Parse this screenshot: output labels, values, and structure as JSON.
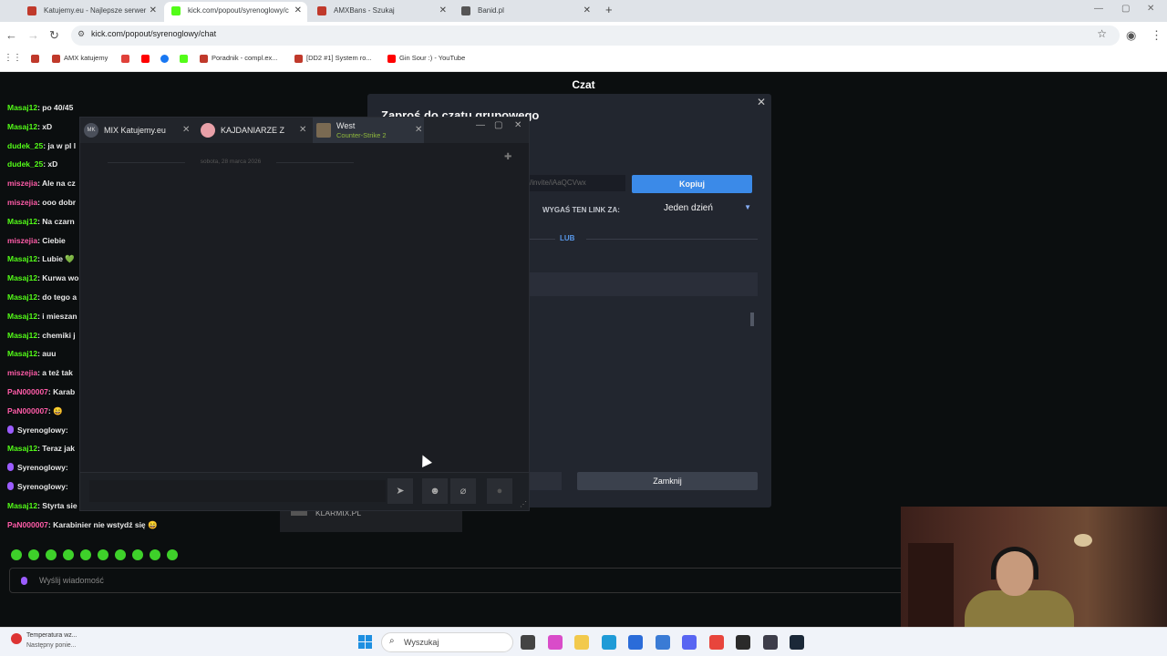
{
  "browser": {
    "tabs": [
      {
        "title": "Katujemy.eu - Najlepsze serwer",
        "color": "#c0392b"
      },
      {
        "title": "kick.com/popout/syrenoglowy/c",
        "color": "#53fc18"
      },
      {
        "title": "AMXBans - Szukaj",
        "color": "#c0392b"
      },
      {
        "title": "Banid.pl",
        "color": "#555555"
      }
    ],
    "new_tab": "+",
    "url": "kick.com/popout/syrenoglowy/chat",
    "bookmarks": [
      {
        "label": "",
        "color": "#c0392b"
      },
      {
        "label": "AMX katujemy",
        "color": "#c0392b"
      },
      {
        "label": "",
        "color": "#e0413a"
      },
      {
        "label": "",
        "color": "#ff0000"
      },
      {
        "label": "",
        "color": "#1877f2"
      },
      {
        "label": "",
        "color": "#53fc18"
      },
      {
        "label": "Poradnik - compl.ex...",
        "color": "#c0392b"
      },
      {
        "label": "[DD2 #1] System ro...",
        "color": "#c0392b"
      },
      {
        "label": "Gin Sour :) - YouTube",
        "color": "#ff0000"
      }
    ]
  },
  "page": {
    "header": "Czat"
  },
  "chat": {
    "messages": [
      {
        "user": "Masaj12",
        "text": ": po 40/45",
        "color": "g"
      },
      {
        "user": "Masaj12",
        "text": ": xD",
        "color": "g"
      },
      {
        "user": "dudek_25",
        "text": ": ja w pl l",
        "color": "g"
      },
      {
        "user": "dudek_25",
        "text": ": xD",
        "color": "g"
      },
      {
        "user": "miszejia",
        "text": ": Ale na cz",
        "color": "p"
      },
      {
        "user": "miszejia",
        "text": ": ooo dobr",
        "color": "p"
      },
      {
        "user": "Masaj12",
        "text": ": Na czarn",
        "color": "g"
      },
      {
        "user": "miszejia",
        "text": ": Ciebie",
        "color": "p"
      },
      {
        "user": "Masaj12",
        "text": ": Lubie 💚",
        "color": "g"
      },
      {
        "user": "Masaj12",
        "text": ": Kurwa wo",
        "color": "g"
      },
      {
        "user": "Masaj12",
        "text": ": do tego a",
        "color": "g"
      },
      {
        "user": "Masaj12",
        "text": ": i mieszan",
        "color": "g"
      },
      {
        "user": "Masaj12",
        "text": ": chemiki j",
        "color": "g"
      },
      {
        "user": "Masaj12",
        "text": ": auu",
        "color": "g"
      },
      {
        "user": "miszejia",
        "text": ": a też tak",
        "color": "p"
      },
      {
        "user": "PaN000007",
        "text": ": Karab",
        "color": "p"
      },
      {
        "user": "PaN000007",
        "text": ": 😄",
        "color": "p"
      },
      {
        "user": "Syrenoglowy",
        "text": ":",
        "color": "v",
        "mic": true
      },
      {
        "user": "Masaj12",
        "text": ": Teraz jak",
        "color": "g"
      },
      {
        "user": "Syrenoglowy",
        "text": ":",
        "color": "v",
        "mic": true
      },
      {
        "user": "Syrenoglowy",
        "text": ":",
        "color": "v",
        "mic": true
      },
      {
        "user": "Masaj12",
        "text": ": Styrta sie dopoło",
        "color": "g"
      },
      {
        "user": "PaN000007",
        "text": ": Karabinier nie wstydź się 😄",
        "color": "p"
      }
    ],
    "emote_count": 10,
    "input_placeholder": "Wyślij wiadomość"
  },
  "invite_dialog": {
    "title": "Zaproś do czatu grupowego",
    "link": "/invite/iAaQCVwx",
    "copy_label": "Kopiuj",
    "expire_label": "WYGAŚ TEN LINK ZA:",
    "expire_value": "Jeden dzień",
    "or_label": "LUB",
    "close_label": "Zamknij"
  },
  "steam_chat": {
    "tabs": [
      {
        "name": "MIX Katujemy.eu",
        "avatar": "MK"
      },
      {
        "name": "KAJDANIARZE Z",
        "avatar": ""
      },
      {
        "name": "West",
        "game": "Counter-Strike 2"
      }
    ],
    "date_divider": "sobota, 28 marca 2026",
    "buttons": [
      "send",
      "emoji",
      "attach",
      "voice"
    ]
  },
  "klarmix": {
    "label": "KLARMIX.PL"
  },
  "taskbar": {
    "weather_line1": "Temperatura wz...",
    "weather_line2": "Następny ponie...",
    "search_placeholder": "Wyszukaj",
    "apps": [
      {
        "name": "task-view",
        "color": "#444444"
      },
      {
        "name": "copilot",
        "color": "#d94cc9"
      },
      {
        "name": "explorer",
        "color": "#f2c94c"
      },
      {
        "name": "edge",
        "color": "#1f9bd7"
      },
      {
        "name": "store",
        "color": "#2b6cd9"
      },
      {
        "name": "outlook",
        "color": "#3a7bd5"
      },
      {
        "name": "discord",
        "color": "#5865f2"
      },
      {
        "name": "chrome",
        "color": "#e8453c"
      },
      {
        "name": "app-green",
        "color": "#2a2a2a"
      },
      {
        "name": "obs",
        "color": "#3d3d4a"
      },
      {
        "name": "steam",
        "color": "#1b2838"
      }
    ]
  }
}
